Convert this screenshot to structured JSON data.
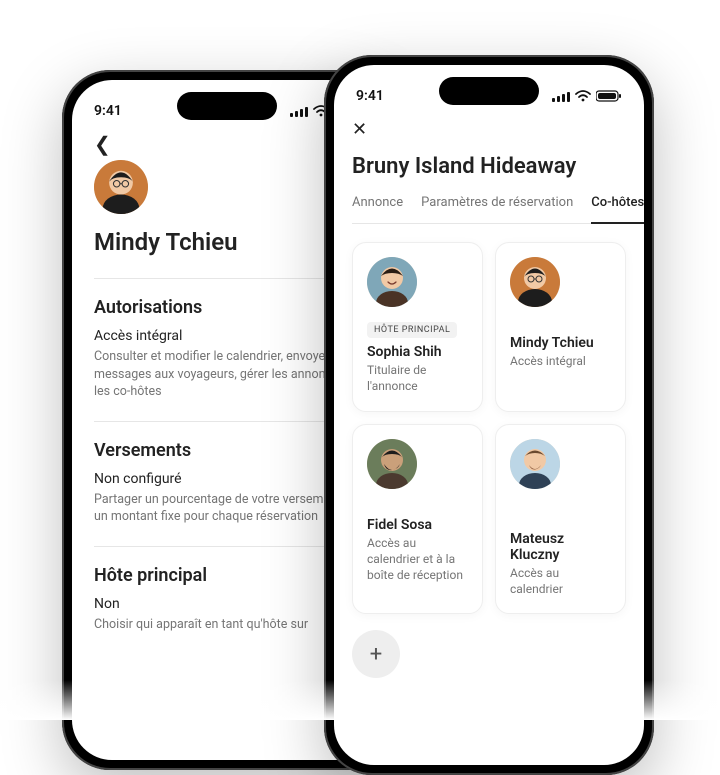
{
  "status_time": "9:41",
  "phone_a": {
    "person_name": "Mindy Tchieu",
    "sections": [
      {
        "title": "Autorisations",
        "sub": "Accès intégral",
        "desc": "Consulter et modifier le calendrier, envoyer des messages aux voyageurs, gérer les annonces et les co-hôtes"
      },
      {
        "title": "Versements",
        "sub": "Non configuré",
        "desc": "Partager un pourcentage de votre versement ou un montant fixe pour chaque réservation"
      },
      {
        "title": "Hôte principal",
        "sub": "Non",
        "desc": "Choisir qui apparaît en tant qu'hôte sur"
      }
    ]
  },
  "phone_b": {
    "title": "Bruny Island Hideaway",
    "tabs": {
      "listing": "Annonce",
      "booking": "Paramètres de réservation",
      "cohosts": "Co-hôtes"
    },
    "badge_primary": "HÔTE PRINCIPAL",
    "hosts": [
      {
        "name": "Sophia Shih",
        "meta": "Titulaire de l'annonce",
        "primary": true,
        "avatar": "sophia"
      },
      {
        "name": "Mindy Tchieu",
        "meta": "Accès intégral",
        "primary": false,
        "avatar": "mindy"
      },
      {
        "name": "Fidel Sosa",
        "meta": "Accès au calendrier et à la boîte de réception",
        "primary": false,
        "avatar": "fidel"
      },
      {
        "name": "Mateusz Kluczny",
        "meta": "Accès au calendrier",
        "primary": false,
        "avatar": "mateusz"
      }
    ],
    "add_label": "+"
  }
}
